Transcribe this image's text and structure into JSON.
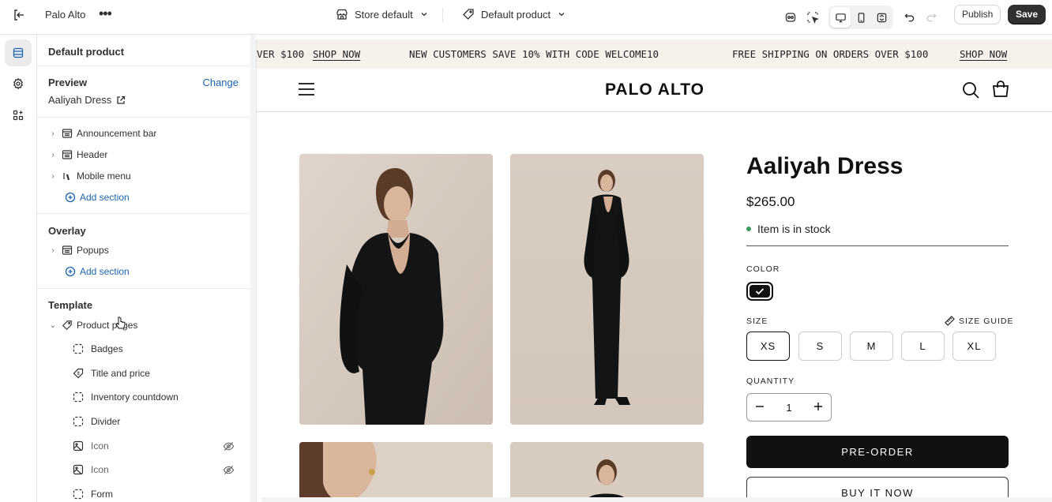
{
  "topbar": {
    "store_name": "Palo Alto",
    "theme_selector": "Store default",
    "template_selector": "Default product",
    "publish_label": "Publish",
    "save_label": "Save",
    "icons": [
      "exit-icon",
      "more-icon",
      "store-icon",
      "tag-icon",
      "inspector-icon",
      "select-icon",
      "desktop-icon",
      "mobile-icon",
      "fullscreen-icon",
      "undo-icon",
      "redo-icon"
    ]
  },
  "rail": {
    "items": [
      "sections-icon",
      "settings-icon",
      "apps-icon"
    ]
  },
  "sidebar": {
    "title": "Default product",
    "preview_label": "Preview",
    "change_label": "Change",
    "preview_product": "Aaliyah Dress",
    "header_group": [
      "Announcement bar",
      "Header",
      "Mobile menu"
    ],
    "add_section": "Add section",
    "overlay_label": "Overlay",
    "overlay_items": [
      "Popups"
    ],
    "template_label": "Template",
    "template_root": "Product pages",
    "blocks": [
      {
        "label": "Badges",
        "hidden": false
      },
      {
        "label": "Title and price",
        "hidden": false
      },
      {
        "label": "Inventory countdown",
        "hidden": false
      },
      {
        "label": "Divider",
        "hidden": false
      },
      {
        "label": "Icon",
        "hidden": true
      },
      {
        "label": "Icon",
        "hidden": true
      },
      {
        "label": "Form",
        "hidden": false
      }
    ]
  },
  "preview": {
    "announcement": {
      "left_fragment": "VER $100",
      "left_link": "SHOP NOW",
      "middle": "NEW CUSTOMERS SAVE 10% WITH CODE WELCOME10",
      "right_text": "FREE SHIPPING ON ORDERS OVER $100",
      "right_link": "SHOP NOW"
    },
    "logo": "PALO ALTO",
    "product": {
      "title": "Aaliyah Dress",
      "price": "$265.00",
      "stock": "Item is in stock",
      "color_label": "COLOR",
      "size_label": "SIZE",
      "size_guide": "SIZE GUIDE",
      "sizes": [
        "XS",
        "S",
        "M",
        "L",
        "XL"
      ],
      "selected_size": "XS",
      "quantity_label": "QUANTITY",
      "quantity": "1",
      "preorder_label": "PRE-ORDER",
      "buynow_label": "BUY IT NOW"
    },
    "colors": {
      "stock_dot": "#3a9a5b",
      "photo_bg": "#d9ccc1",
      "accent_link": "#1a64b0"
    }
  }
}
